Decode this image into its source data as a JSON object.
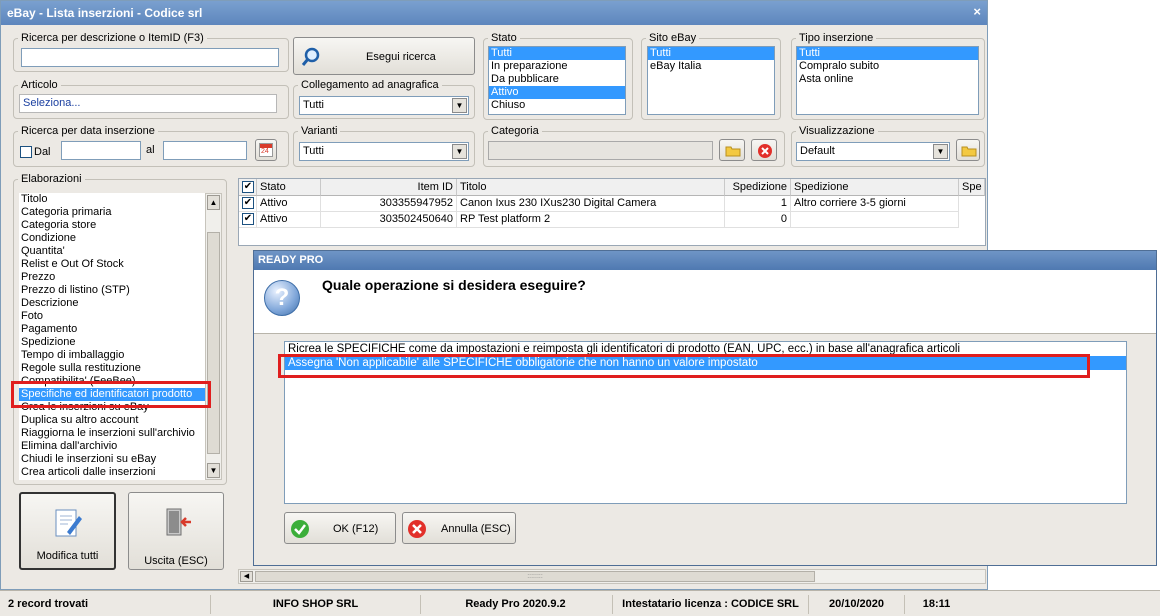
{
  "window": {
    "title": "eBay - Lista inserzioni - Codice srl",
    "close_glyph": "×"
  },
  "search": {
    "label": "Ricerca per descrizione o ItemID (F3)",
    "value": "",
    "button_label": "Esegui ricerca"
  },
  "articolo": {
    "label": "Articolo",
    "value": "Seleziona..."
  },
  "collegamento": {
    "label": "Collegamento ad anagrafica",
    "value": "Tutti"
  },
  "stato": {
    "label": "Stato",
    "items": [
      "Tutti",
      "In preparazione",
      "Da pubblicare",
      "Attivo",
      "Chiuso"
    ],
    "selected_indexes": [
      0,
      3
    ]
  },
  "sito": {
    "label": "Sito eBay",
    "items": [
      "Tutti",
      "eBay Italia"
    ],
    "selected_indexes": [
      0
    ]
  },
  "tipo": {
    "label": "Tipo inserzione",
    "items": [
      "Tutti",
      "Compralo subito",
      "Asta online"
    ],
    "selected_indexes": [
      0
    ]
  },
  "data": {
    "label": "Ricerca per data inserzione",
    "dal_label": "Dal",
    "al_label": "al",
    "dal_value": "",
    "al_value": "",
    "calendar_day": "24"
  },
  "varianti": {
    "label": "Varianti",
    "value": "Tutti"
  },
  "categoria": {
    "label": "Categoria",
    "value": ""
  },
  "visualizzazione": {
    "label": "Visualizzazione",
    "value": "Default"
  },
  "elaborazioni": {
    "label": "Elaborazioni",
    "items": [
      "Titolo",
      "Categoria primaria",
      "Categoria store",
      "Condizione",
      "Quantita'",
      "Relist e Out Of Stock",
      "Prezzo",
      "Prezzo di listino (STP)",
      "Descrizione",
      "Foto",
      "Pagamento",
      "Spedizione",
      "Tempo di imballaggio",
      "Regole sulla restituzione",
      "Compatibilita' (FeeBee)",
      "Specifiche ed identificatori prodotto",
      "Crea le inserzioni su eBay",
      "Duplica su altro account",
      "Riaggiorna le inserzioni sull'archivio",
      "Elimina dall'archivio",
      "Chiudi le inserzioni su eBay",
      "Crea articoli dalle inserzioni"
    ],
    "selected_index": 15
  },
  "actions": {
    "modifica_label": "Modifica tutti",
    "uscita_label": "Uscita (ESC)"
  },
  "grid": {
    "columns": [
      "Stato",
      "Item ID",
      "Titolo",
      "Spedizione",
      "Spedizione",
      "Spe"
    ],
    "rows": [
      {
        "checked": true,
        "stato": "Attivo",
        "item_id": "303355947952",
        "titolo": "Canon Ixus 230 IXus230 Digital Camera",
        "spedizione_qty": "1",
        "spedizione": "Altro corriere 3-5 giorni"
      },
      {
        "checked": true,
        "stato": "Attivo",
        "item_id": "303502450640",
        "titolo": "RP Test platform 2",
        "spedizione_qty": "0",
        "spedizione": ""
      }
    ],
    "scroll_grip": "::::::::"
  },
  "dialog": {
    "title": "READY PRO",
    "question": "Quale operazione si desidera eseguire?",
    "question_glyph": "?",
    "options": [
      "Ricrea le SPECIFICHE come da impostazioni e reimposta gli identificatori di prodotto (EAN, UPC, ecc.) in base all'anagrafica articoli",
      "Assegna 'Non applicabile' alle SPECIFICHE obbligatorie che non hanno un valore impostato"
    ],
    "selected_option": 1,
    "ok_label": "OK (F12)",
    "cancel_label": "Annulla (ESC)"
  },
  "statusbar": {
    "records": "2 record trovati",
    "company": "INFO SHOP SRL",
    "version": "Ready Pro 2020.9.2",
    "license": "Intestatario licenza : CODICE SRL",
    "date": "20/10/2020",
    "time": "18:11"
  },
  "colors": {
    "selection": "#3399ff",
    "highlight_box": "#e01e1e",
    "title_blue": "#5d86bd"
  }
}
